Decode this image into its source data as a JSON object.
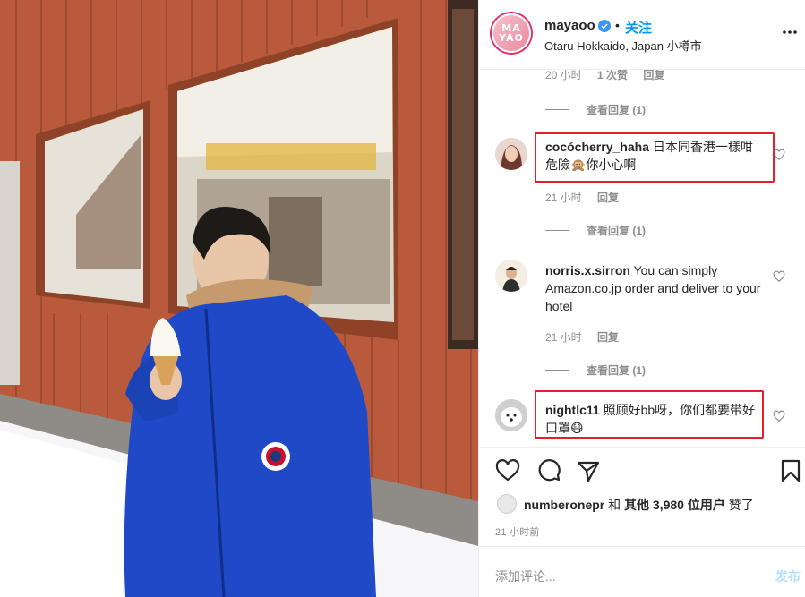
{
  "post": {
    "photo_alt": "Man in blue parka holding a soft-serve ice cream cone in front of a wooden building",
    "author": {
      "username": "mayaoo",
      "avatar_text_1": "MA",
      "avatar_text_2": "YAO",
      "follow_label": "关注",
      "separator": "•",
      "location": "Otaru Hokkaido, Japan 小樽市"
    }
  },
  "comments": [
    {
      "partial": true,
      "time": "20 小时",
      "likes": "1 次赞",
      "reply_label": "回复",
      "view_replies": "查看回复 (1)"
    },
    {
      "username": "cocócherry_haha",
      "text": "日本同香港一樣咁危險🙊你小心啊",
      "time": "21 小时",
      "reply_label": "回复",
      "view_replies": "查看回复 (1)",
      "highlighted": true
    },
    {
      "username": "norris.x.sirron",
      "text": "You can simply Amazon.co.jp order and deliver to your hotel",
      "time": "21 小时",
      "reply_label": "回复",
      "view_replies": "查看回复 (1)",
      "highlighted": false
    },
    {
      "username": "nightlc11",
      "text": "照顾好bb呀，你们都要带好口罩😷",
      "highlighted": true
    }
  ],
  "actions": {
    "like_icon": "heart-outline-icon",
    "comment_icon": "comment-bubble-icon",
    "share_icon": "paper-plane-icon",
    "save_icon": "bookmark-icon"
  },
  "likes": {
    "liker": "numberonepr",
    "joiner": "和",
    "others_label": "其他 3,980 位用户",
    "suffix": "赞了"
  },
  "timestamp": "21 小时前",
  "add_comment": {
    "placeholder": "添加评论...",
    "post_label": "发布"
  },
  "colors": {
    "accent": "#0095f6",
    "highlight": "#e5202a",
    "text": "#262626",
    "muted": "#8e8e8e",
    "post_disabled": "#b2dffc"
  }
}
